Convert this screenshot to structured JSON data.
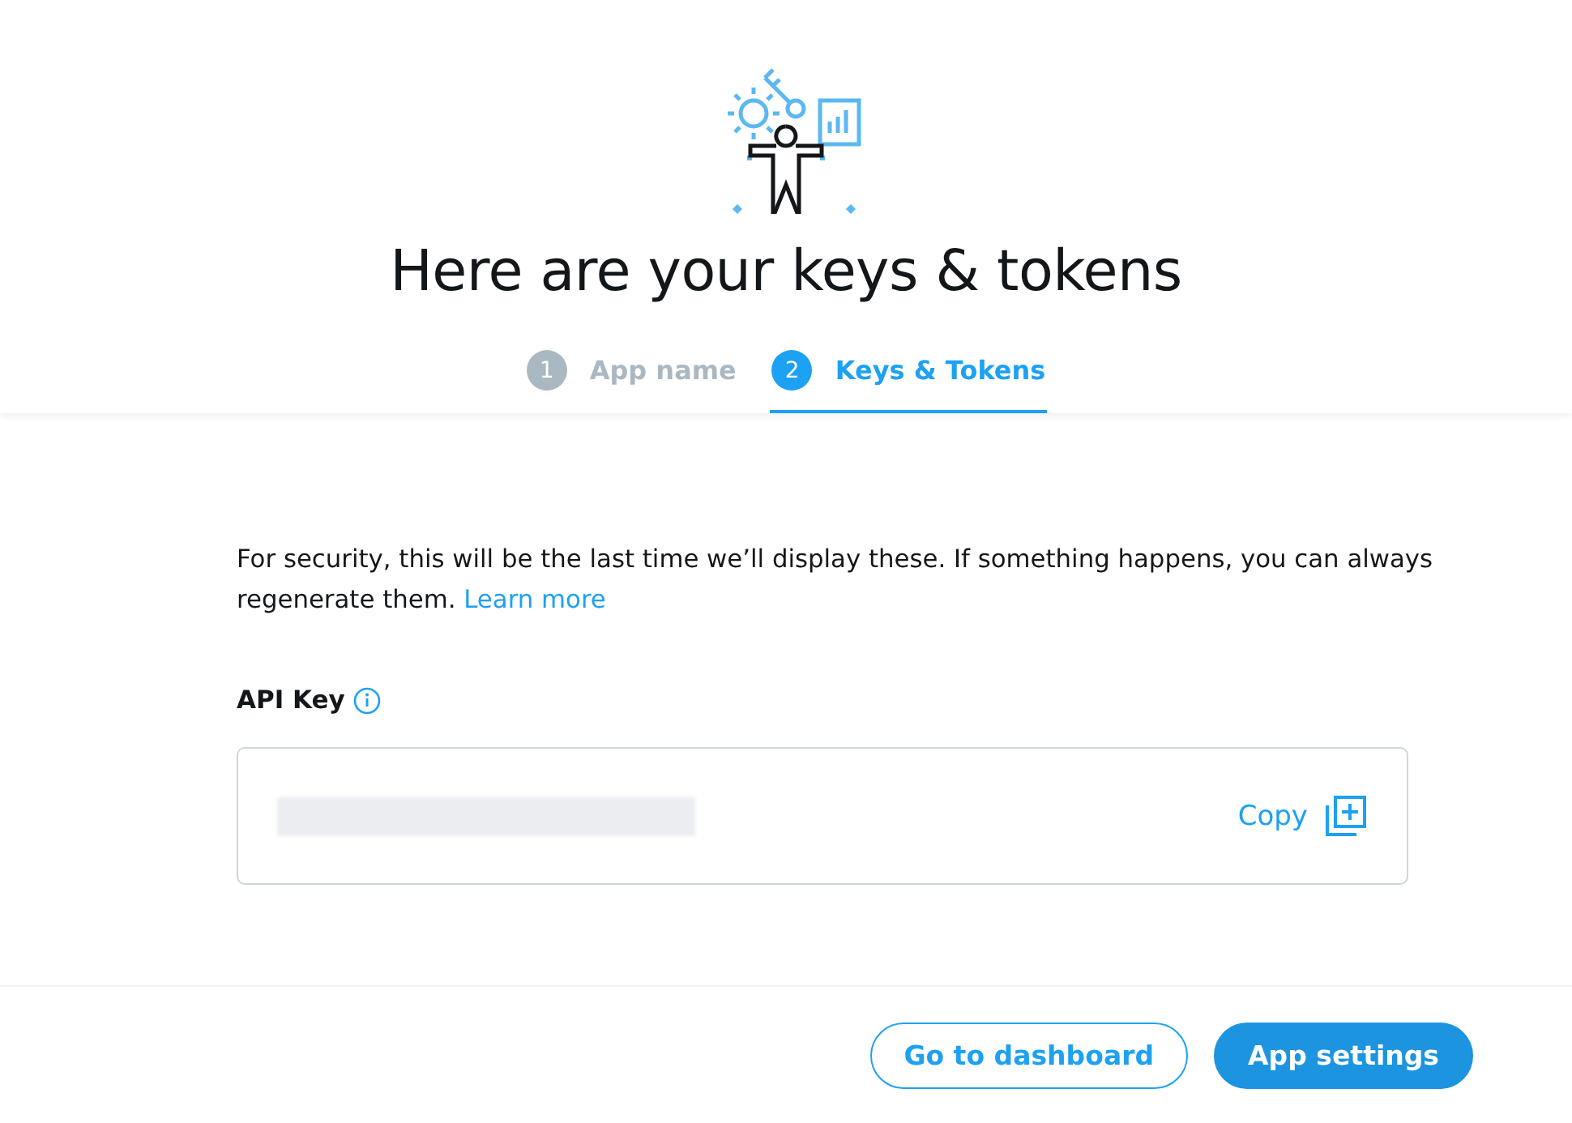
{
  "title": "Here are your keys & tokens",
  "steps": [
    {
      "number": "1",
      "label": "App name",
      "selected": false
    },
    {
      "number": "2",
      "label": "Keys & Tokens",
      "selected": true
    }
  ],
  "notice": {
    "text": "For security, this will be the last time we’ll display these. If something happens, you can always regenerate them.",
    "link": "Learn more"
  },
  "api_key": {
    "label": "API Key",
    "value": {
      "kind": "redacted"
    },
    "copy": "Copy"
  },
  "buttons": [
    {
      "label": "Go to dashboard",
      "kind": "secondary"
    },
    {
      "label": "App settings",
      "kind": "primary"
    }
  ]
}
